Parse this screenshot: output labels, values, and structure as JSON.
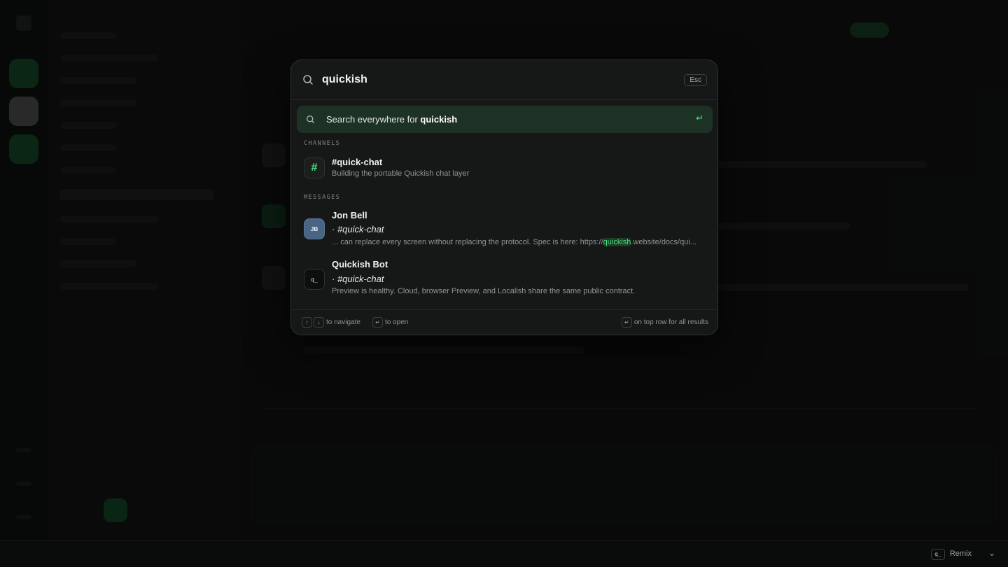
{
  "background_app": {
    "bottom_bar": {
      "logo_glyph": "q_",
      "workspace_label": "Remix",
      "chevron": "⌄"
    }
  },
  "palette": {
    "query": "quickish",
    "placeholder": "",
    "esc_label": "Esc",
    "search_everywhere": {
      "prefix": "Search everywhere for ",
      "term": "quickish",
      "enter_glyph": "↵"
    },
    "sections": {
      "channels": "CHANNELS",
      "messages": "MESSAGES"
    },
    "channels": [
      {
        "icon_glyph": "#",
        "name": "#quick-chat",
        "description": "Building the portable Quickish chat layer"
      }
    ],
    "messages": [
      {
        "avatar_text": "JB",
        "author": "Jon Bell",
        "channel_prefix": "· ",
        "channel": "#quick-chat",
        "snippet_before": "... can replace every screen without replacing the protocol. Spec is here: https://",
        "snippet_highlight": "quickish",
        "snippet_after": ".website/docs/qui..."
      },
      {
        "avatar_text": "q_",
        "author": "Quickish Bot",
        "channel_prefix": "· ",
        "channel": "#quick-chat",
        "snippet_before": "Preview is healthy. Cloud, browser Preview, and Localish share the same public contract.",
        "snippet_highlight": "",
        "snippet_after": ""
      }
    ],
    "footer": {
      "navigate_up": "↑",
      "navigate_down": "↓",
      "navigate_label": "to navigate",
      "open_key": "↵",
      "open_label": "to open",
      "all_key": "↵",
      "all_label": "on top row for all results"
    }
  },
  "colors": {
    "accent": "#4ade80",
    "highlight_bg": "#1d3225",
    "jb_avatar": "#4a6583"
  },
  "icons": [
    "search-icon",
    "enter-icon",
    "hash-icon",
    "bot-icon",
    "chevron-down-icon"
  ]
}
